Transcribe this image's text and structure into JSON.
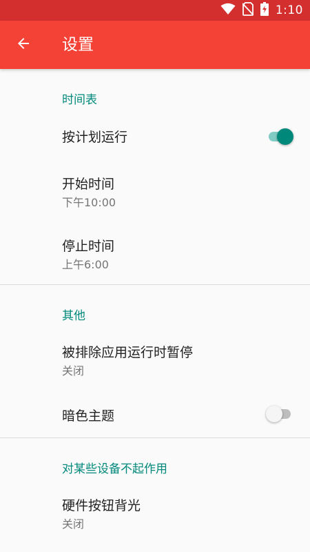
{
  "status_bar": {
    "time": "1:10",
    "icons": [
      "wifi-icon",
      "no-sim-icon",
      "battery-charging-icon"
    ]
  },
  "app_bar": {
    "title": "设置",
    "back_icon": "arrow-left-icon"
  },
  "sections": [
    {
      "header": "时间表",
      "items": [
        {
          "title": "按计划运行",
          "type": "switch",
          "checked": true
        },
        {
          "title": "开始时间",
          "summary": "下午10:00"
        },
        {
          "title": "停止时间",
          "summary": "上午6:00"
        }
      ]
    },
    {
      "header": "其他",
      "items": [
        {
          "title": "被排除应用运行时暂停",
          "summary": "关闭"
        },
        {
          "title": "暗色主题",
          "type": "switch",
          "checked": false
        }
      ]
    },
    {
      "header": "对某些设备不起作用",
      "items": [
        {
          "title": "硬件按钮背光",
          "summary": "关闭"
        }
      ]
    }
  ],
  "colors": {
    "status_bar": "#d32f2f",
    "app_bar": "#f44336",
    "accent": "#00897b",
    "accent_track": "#80cbc4"
  }
}
